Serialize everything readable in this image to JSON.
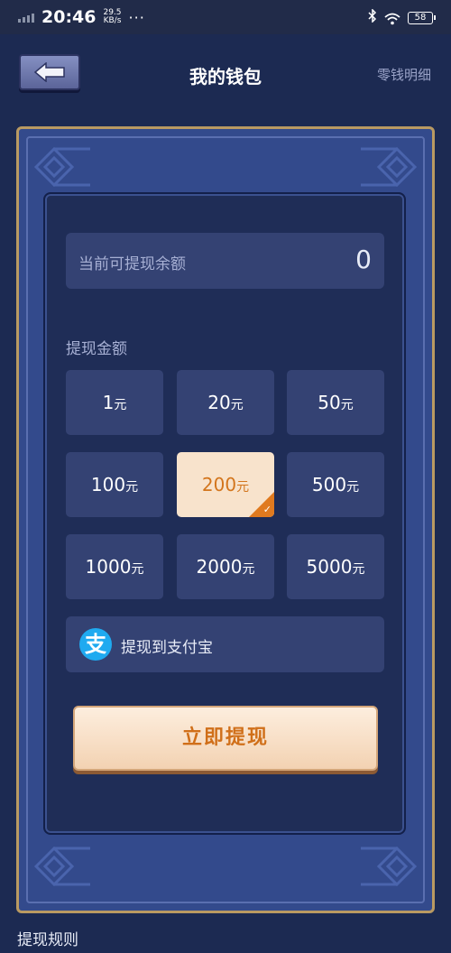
{
  "status_bar": {
    "time": "20:46",
    "speed_value": "29.5",
    "speed_unit": "KB/s",
    "more": "···",
    "battery": "58"
  },
  "header": {
    "title": "我的钱包",
    "detail_link": "零钱明细"
  },
  "balance": {
    "label": "当前可提现余额",
    "value": "0"
  },
  "amount_section": {
    "label": "提现金额"
  },
  "amounts": [
    {
      "value": "1",
      "unit": "元"
    },
    {
      "value": "20",
      "unit": "元"
    },
    {
      "value": "50",
      "unit": "元"
    },
    {
      "value": "100",
      "unit": "元"
    },
    {
      "value": "200",
      "unit": "元"
    },
    {
      "value": "500",
      "unit": "元"
    },
    {
      "value": "1000",
      "unit": "元"
    },
    {
      "value": "2000",
      "unit": "元"
    },
    {
      "value": "5000",
      "unit": "元"
    }
  ],
  "selected_amount": "200",
  "payment": {
    "icon_char": "支",
    "label": "提现到支付宝"
  },
  "withdraw_button": {
    "label": "立即提现"
  },
  "rules": {
    "title": "提现规则"
  },
  "colors": {
    "background": "#1c2a52",
    "frame_gold": "#b99a62",
    "accent_orange": "#d3751c",
    "selected_bg": "#f8e3cc",
    "alipay_blue": "#1faaf0"
  }
}
